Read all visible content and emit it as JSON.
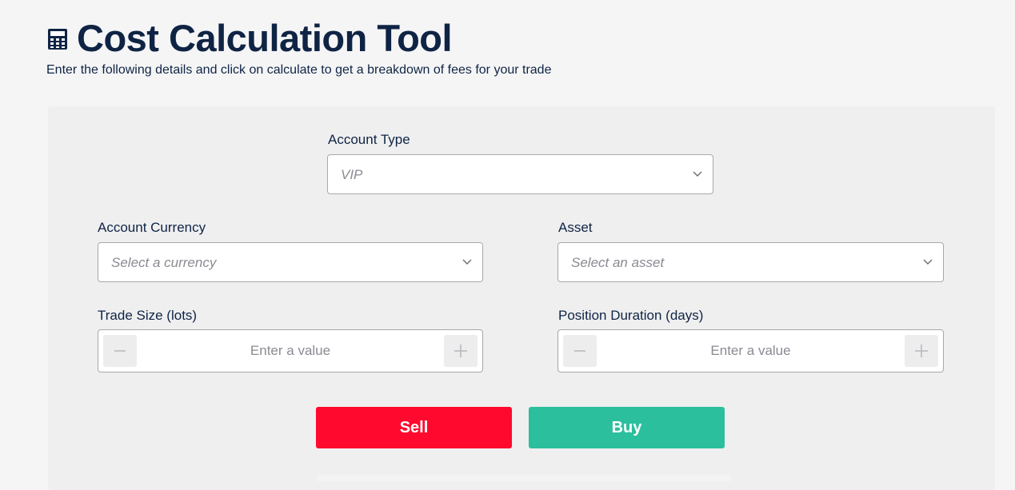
{
  "header": {
    "title": "Cost Calculation Tool",
    "subtitle": "Enter the following details and click on calculate to get a breakdown of fees for your trade",
    "icon": "calculator-icon"
  },
  "form": {
    "account_type": {
      "label": "Account Type",
      "value": "VIP"
    },
    "account_currency": {
      "label": "Account Currency",
      "placeholder": "Select a currency"
    },
    "asset": {
      "label": "Asset",
      "placeholder": "Select an asset"
    },
    "trade_size": {
      "label": "Trade Size (lots)",
      "placeholder": "Enter a value"
    },
    "position_duration": {
      "label": "Position Duration (days)",
      "placeholder": "Enter a value"
    }
  },
  "actions": {
    "sell_label": "Sell",
    "buy_label": "Buy"
  },
  "colors": {
    "navy": "#0f2444",
    "sell": "#ff0a2e",
    "buy": "#2bbf9d",
    "card": "#efeff0",
    "page": "#f5f5f6"
  }
}
